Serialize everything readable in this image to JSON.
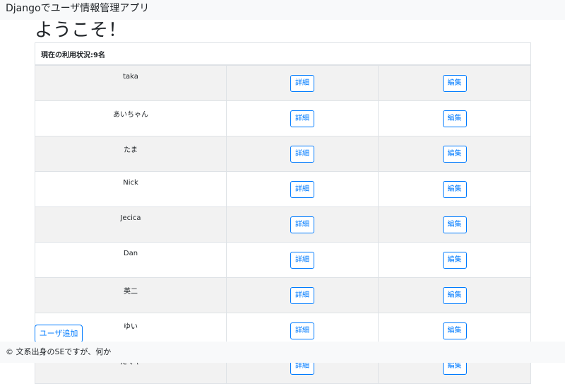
{
  "navbar": {
    "brand": "Djangoでユーザ情報管理アプリ"
  },
  "page": {
    "title": "ようこそ！"
  },
  "table": {
    "header": "現在の利用状況:9名",
    "detail_label": "詳細",
    "edit_label": "編集",
    "users": [
      {
        "name": "taka"
      },
      {
        "name": "あいちゃん"
      },
      {
        "name": "たま"
      },
      {
        "name": "Nick"
      },
      {
        "name": "Jecica"
      },
      {
        "name": "Dan"
      },
      {
        "name": "英二"
      },
      {
        "name": "ゆい"
      },
      {
        "name": "たくや"
      }
    ]
  },
  "actions": {
    "add_user_label": "ユーザ追加"
  },
  "footer": {
    "text": "© 文系出身のSEですが、何か"
  }
}
